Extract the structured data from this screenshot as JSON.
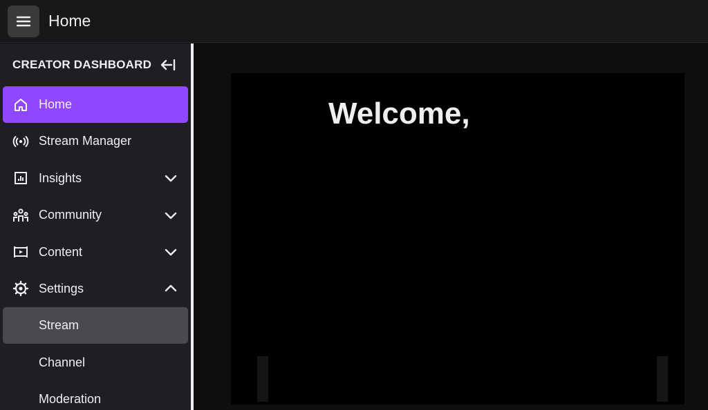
{
  "topbar": {
    "menu_icon": "hamburger-menu-icon",
    "title": "Home"
  },
  "sidebar": {
    "title": "CREATOR DASHBOARD",
    "collapse_icon": "collapse-left-icon",
    "items": [
      {
        "label": "Home",
        "icon": "home-icon",
        "active": true
      },
      {
        "label": "Stream Manager",
        "icon": "broadcast-icon"
      },
      {
        "label": "Insights",
        "icon": "chart-icon",
        "chevron": "down"
      },
      {
        "label": "Community",
        "icon": "people-icon",
        "chevron": "down"
      },
      {
        "label": "Content",
        "icon": "film-icon",
        "chevron": "down"
      },
      {
        "label": "Settings",
        "icon": "gear-icon",
        "chevron": "up"
      }
    ],
    "settings_sub": [
      {
        "label": "Stream",
        "selected": true
      },
      {
        "label": "Channel"
      },
      {
        "label": "Moderation"
      }
    ]
  },
  "main": {
    "welcome": "Welcome,"
  },
  "colors": {
    "accent": "#9147ff",
    "sidebar_bg": "#1f1f23",
    "topbar_bg": "#18181b",
    "selected_bg": "#4a4a4e"
  }
}
